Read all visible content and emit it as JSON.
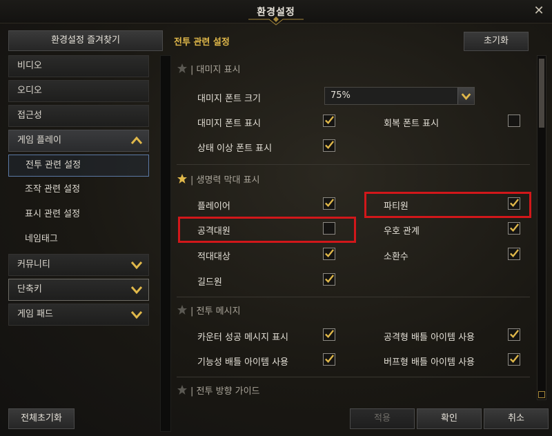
{
  "window": {
    "title": "환경설정"
  },
  "sidebar": {
    "favorites_label": "환경설정 즐겨찾기",
    "items": [
      {
        "label": "비디오"
      },
      {
        "label": "오디오"
      },
      {
        "label": "접근성"
      },
      {
        "label": "게임 플레이"
      },
      {
        "label": "전투 관련 설정"
      },
      {
        "label": "조작 관련 설정"
      },
      {
        "label": "표시 관련 설정"
      },
      {
        "label": "네임태그"
      },
      {
        "label": "커뮤니티"
      },
      {
        "label": "단축키"
      },
      {
        "label": "게임 패드"
      }
    ],
    "reset_all_label": "전체초기화"
  },
  "main": {
    "section_title": "전투 관련 설정",
    "init_label": "초기화",
    "groups": {
      "damage": {
        "title": "대미지 표시",
        "font_size_label": "대미지 폰트 크기",
        "font_size_value": "75%",
        "show_damage_font": "대미지 폰트 표시",
        "show_heal_font": "회복 폰트 표시",
        "show_status_font": "상태 이상 폰트 표시"
      },
      "health_bar": {
        "title": "생명력 막대 표시",
        "player": "플레이어",
        "party": "파티원",
        "raid": "공격대원",
        "friendly": "우호 관계",
        "enemy": "적대대상",
        "summon": "소환수",
        "guild": "길드원"
      },
      "combat_message": {
        "title": "전투 메시지",
        "counter_success": "카운터 성공 메시지 표시",
        "offensive_item": "공격형 배틀 아이템 사용",
        "utility_item": "기능성 배틀 아이템 사용",
        "buff_item": "버프형 배틀 아이템 사용"
      },
      "direction_guide": {
        "title": "전투 방향 가이드"
      }
    }
  },
  "footer": {
    "apply_label": "적용",
    "ok_label": "확인",
    "cancel_label": "취소"
  },
  "colors": {
    "accent_gold": "#e0b84a",
    "highlight_red": "#d2171a",
    "active_blue": "#5c7aa6"
  }
}
